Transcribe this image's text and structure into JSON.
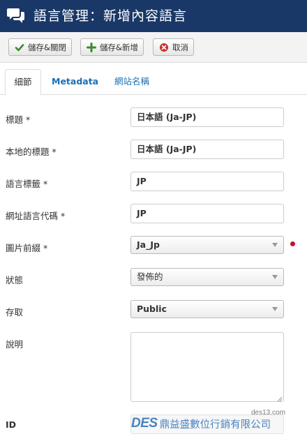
{
  "header": {
    "icon": "chat-bubbles-icon",
    "title": "語言管理：新增內容語言"
  },
  "toolbar": {
    "save_close_label": "儲存&關閉",
    "save_new_label": "儲存&新增",
    "cancel_label": "取消",
    "colors": {
      "save_icon": "#3c8a2e",
      "new_icon": "#3c8a2e",
      "cancel_icon": "#c9302c"
    }
  },
  "tabs": [
    {
      "label": "細節",
      "active": true
    },
    {
      "label": "Metadata",
      "active": false
    },
    {
      "label": "網站名稱",
      "active": false
    }
  ],
  "form": {
    "title_label": "標題 *",
    "title_value": "日本語 (Ja-JP)",
    "native_title_label": "本地的標題 *",
    "native_title_value": "日本語 (Ja-JP)",
    "lang_tag_label": "語言標籤 *",
    "lang_tag_value": "JP",
    "url_code_label": "網址語言代碼 *",
    "url_code_value": "JP",
    "image_prefix_label": "圖片前綴 *",
    "image_prefix_value": "Ja_Jp",
    "status_label": "狀態",
    "status_value": "發佈的",
    "access_label": "存取",
    "access_value": "Public",
    "description_label": "說明",
    "description_value": "",
    "id_label": "ID",
    "id_value": ""
  },
  "watermark": {
    "url": "des13.com",
    "logo": "DES",
    "company": "鼎益盛數位行銷有限公司"
  },
  "colors": {
    "header_bg": "#1a3867",
    "link": "#1b6fb5",
    "required_dot": "#c8102e"
  }
}
